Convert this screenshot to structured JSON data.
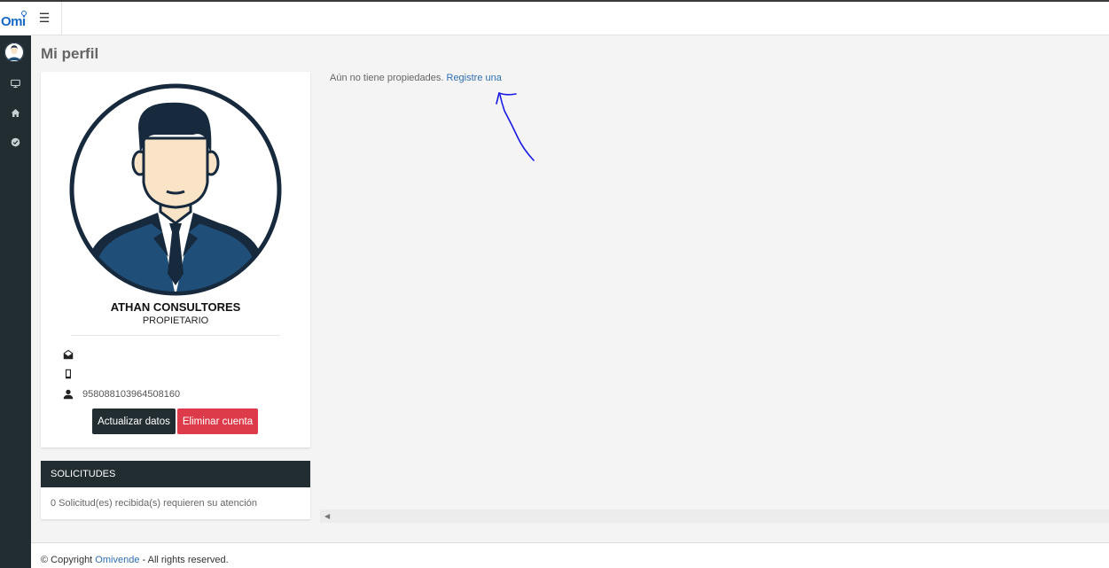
{
  "app": {
    "logo_text": "Omi"
  },
  "page": {
    "title": "Mi perfil"
  },
  "profile": {
    "name": "ATHAN CONSULTORES",
    "role": "PROPIETARIO",
    "email": "",
    "phone": "",
    "id_number": "958088103964508160",
    "update_button": "Actualizar datos",
    "delete_button": "Eliminar cuenta"
  },
  "requests": {
    "title": "SOLICITUDES",
    "message": "0 Solicitud(es) recibida(s) requieren su atención"
  },
  "properties": {
    "empty_text": "Aún no tiene propiedades.",
    "register_link": "Registre una"
  },
  "footer": {
    "prefix": "© Copyright ",
    "brand": "Omivende",
    "suffix": " - All rights reserved."
  },
  "colors": {
    "sidebar": "#222d32",
    "accent_link": "#2f6fb5",
    "danger": "#dd3b4a",
    "annotation": "#1a1ae6"
  }
}
